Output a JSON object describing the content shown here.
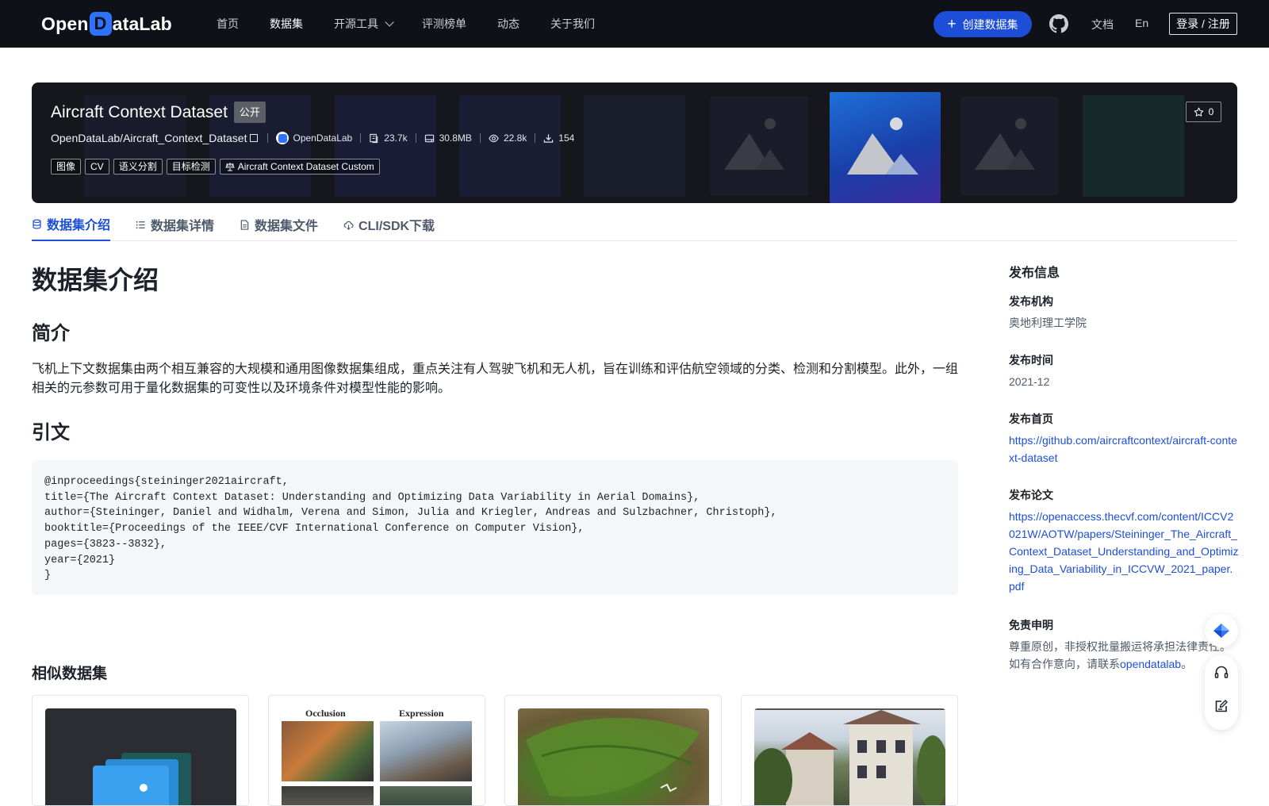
{
  "nav": {
    "logo_pre": "Open",
    "logo_d": "D",
    "logo_post": "ataLab",
    "items": [
      {
        "label": "首页",
        "active": false
      },
      {
        "label": "数据集",
        "active": true
      },
      {
        "label": "开源工具",
        "active": false,
        "dropdown": true
      },
      {
        "label": "评测榜单",
        "active": false
      },
      {
        "label": "动态",
        "active": false
      },
      {
        "label": "关于我们",
        "active": false
      }
    ],
    "create_label": "创建数据集",
    "docs_label": "文档",
    "lang_label": "En",
    "login_label": "登录 / 注册"
  },
  "dataset": {
    "title": "Aircraft Context Dataset",
    "visibility": "公开",
    "path": "OpenDataLab/Aircraft_Context_Dataset",
    "org": "OpenDataLab",
    "stats": {
      "file_count": "23.7k",
      "size": "30.8MB",
      "views": "22.8k",
      "downloads": "154"
    },
    "tags": [
      "图像",
      "CV",
      "语义分割",
      "目标检测"
    ],
    "license": "Aircraft Context Dataset Custom",
    "stars": "0"
  },
  "tabs": [
    {
      "label": "数据集介绍",
      "icon": "database-icon",
      "active": true
    },
    {
      "label": "数据集详情",
      "icon": "list-icon",
      "active": false
    },
    {
      "label": "数据集文件",
      "icon": "file-icon",
      "active": false
    },
    {
      "label": "CLI/SDK下载",
      "icon": "cloud-download-icon",
      "active": false
    }
  ],
  "content": {
    "heading": "数据集介绍",
    "intro_heading": "简介",
    "intro_text": "飞机上下文数据集由两个相互兼容的大规模和通用图像数据集组成，重点关注有人驾驶飞机和无人机，旨在训练和评估航空领域的分类、检测和分割模型。此外，一组相关的元参数可用于量化数据集的可变性以及环境条件对模型性能的影响。",
    "citation_heading": "引文",
    "citation": "@inproceedings{steininger2021aircraft,\ntitle={The Aircraft Context Dataset: Understanding and Optimizing Data Variability in Aerial Domains},\nauthor={Steininger, Daniel and Widhalm, Verena and Simon, Julia and Kriegler, Andreas and Sulzbachner, Christoph},\nbooktitle={Proceedings of the IEEE/CVF International Conference on Computer Vision},\npages={3823--3832},\nyear={2021}\n}",
    "similar_heading": "相似数据集",
    "similar_cards": [
      {
        "thumb_text_1": "",
        "thumb_text_2": ""
      },
      {
        "thumb_text_1": "Occlusion",
        "thumb_text_2": "Expression"
      },
      {
        "thumb_text_1": "",
        "thumb_text_2": ""
      },
      {
        "thumb_text_1": "",
        "thumb_text_2": ""
      }
    ]
  },
  "sidebar": {
    "title": "发布信息",
    "publisher_label": "发布机构",
    "publisher": "奥地利理工学院",
    "date_label": "发布时间",
    "date": "2021-12",
    "homepage_label": "发布首页",
    "homepage": "https://github.com/aircraftcontext/aircraft-context-dataset",
    "paper_label": "发布论文",
    "paper": "https://openaccess.thecvf.com/content/ICCV2021W/AOTW/papers/Steininger_The_Aircraft_Context_Dataset_Understanding_and_Optimizing_Data_Variability_in_ICCVW_2021_paper.pdf",
    "disclaimer_label": "免责申明",
    "disclaimer_1": "尊重原创，非授权批量搬运将承担法律责任。",
    "disclaimer_2": "如有合作意向，请联系",
    "disclaimer_link": "opendatalab",
    "disclaimer_end": "。"
  },
  "colors": {
    "accent": "#1d4ed8",
    "nav_bg": "#0f1119",
    "banner_bg": "#16171c"
  }
}
